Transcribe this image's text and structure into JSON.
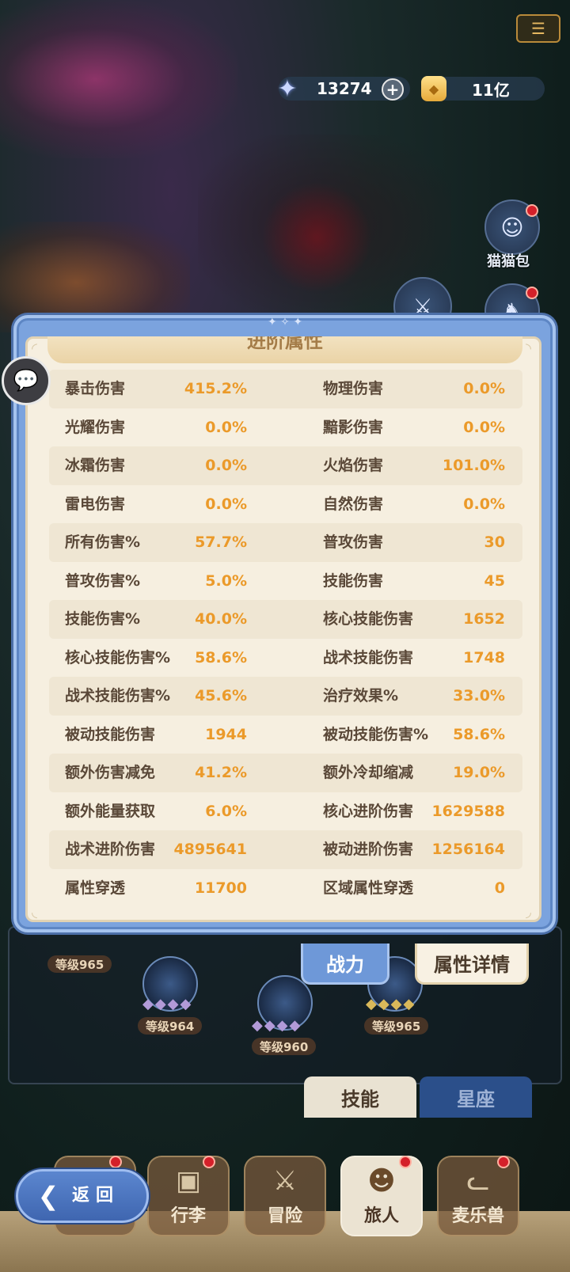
{
  "currency": {
    "star_value": "13274",
    "coin_value": "11亿",
    "star_icon": "star-crystal-icon",
    "coin_icon": "gold-coin-icon"
  },
  "side_buttons": {
    "cat_bag_label": "猫猫包"
  },
  "panel": {
    "header_title": "进阶属性",
    "rows": [
      {
        "left_label": "暴击伤害",
        "left_value": "415.2%",
        "right_label": "物理伤害",
        "right_value": "0.0%"
      },
      {
        "left_label": "光耀伤害",
        "left_value": "0.0%",
        "right_label": "黯影伤害",
        "right_value": "0.0%"
      },
      {
        "left_label": "冰霜伤害",
        "left_value": "0.0%",
        "right_label": "火焰伤害",
        "right_value": "101.0%"
      },
      {
        "left_label": "雷电伤害",
        "left_value": "0.0%",
        "right_label": "自然伤害",
        "right_value": "0.0%"
      },
      {
        "left_label": "所有伤害%",
        "left_value": "57.7%",
        "right_label": "普攻伤害",
        "right_value": "30"
      },
      {
        "left_label": "普攻伤害%",
        "left_value": "5.0%",
        "right_label": "技能伤害",
        "right_value": "45"
      },
      {
        "left_label": "技能伤害%",
        "left_value": "40.0%",
        "right_label": "核心技能伤害",
        "right_value": "1652"
      },
      {
        "left_label": "核心技能伤害%",
        "left_value": "58.6%",
        "right_label": "战术技能伤害",
        "right_value": "1748"
      },
      {
        "left_label": "战术技能伤害%",
        "left_value": "45.6%",
        "right_label": "治疗效果%",
        "right_value": "33.0%"
      },
      {
        "left_label": "被动技能伤害",
        "left_value": "1944",
        "right_label": "被动技能伤害%",
        "right_value": "58.6%"
      },
      {
        "left_label": "额外伤害减免",
        "left_value": "41.2%",
        "right_label": "额外冷却缩减",
        "right_value": "19.0%"
      },
      {
        "left_label": "额外能量获取",
        "left_value": "6.0%",
        "right_label": "核心进阶伤害",
        "right_value": "1629588"
      },
      {
        "left_label": "战术进阶伤害",
        "left_value": "4895641",
        "right_label": "被动进阶伤害",
        "right_value": "1256164"
      },
      {
        "left_label": "属性穿透",
        "left_value": "11700",
        "right_label": "区域属性穿透",
        "right_value": "0"
      }
    ],
    "tabs": {
      "power": "战力",
      "detail": "属性详情"
    }
  },
  "skills": {
    "levels": [
      "等级965",
      "等级964",
      "等级960",
      "等级965"
    ],
    "tabs": {
      "skill": "技能",
      "constellation": "星座"
    }
  },
  "bottom_nav": {
    "back": "返回",
    "items": [
      "行李",
      "冒险",
      "旅人",
      "麦乐兽"
    ]
  },
  "colors": {
    "accent_blue": "#7ba3de",
    "value_orange": "#eb9a2a",
    "panel_bg": "#f6efe0"
  }
}
